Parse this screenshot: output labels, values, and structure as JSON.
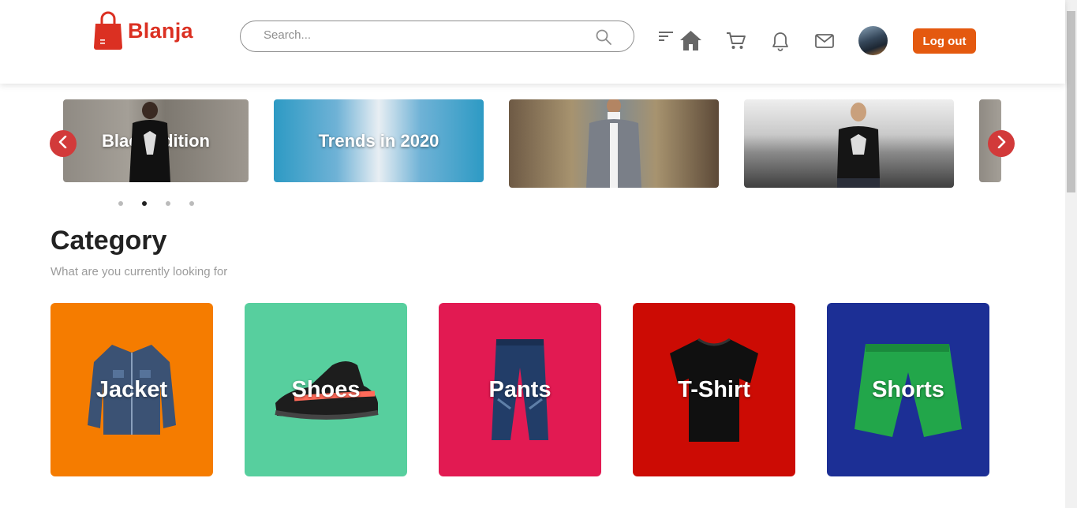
{
  "header": {
    "logo_text": "Blanja",
    "search_placeholder": "Search...",
    "logout_label": "Log out",
    "icons": [
      "filter-icon",
      "home-icon",
      "cart-icon",
      "bell-icon",
      "mail-icon"
    ]
  },
  "carousel": {
    "slides": [
      {
        "label": "Black edition"
      },
      {
        "label": "Trends in 2020"
      },
      {
        "label": ""
      },
      {
        "label": ""
      },
      {
        "label": ""
      }
    ],
    "active_dot": 2,
    "dot_count": 4,
    "arrow_color": "#d23a3a"
  },
  "category": {
    "title": "Category",
    "subtitle": "What are you currently looking for",
    "cards": [
      {
        "label": "Jacket",
        "color": "#f57c00"
      },
      {
        "label": "Shoes",
        "color": "#57cf9e"
      },
      {
        "label": "Pants",
        "color": "#e21a52"
      },
      {
        "label": "T-Shirt",
        "color": "#cc0b04"
      },
      {
        "label": "Shorts",
        "color": "#1c2f95"
      }
    ]
  },
  "colors": {
    "brand": "#db3022",
    "logout": "#e4590f"
  }
}
